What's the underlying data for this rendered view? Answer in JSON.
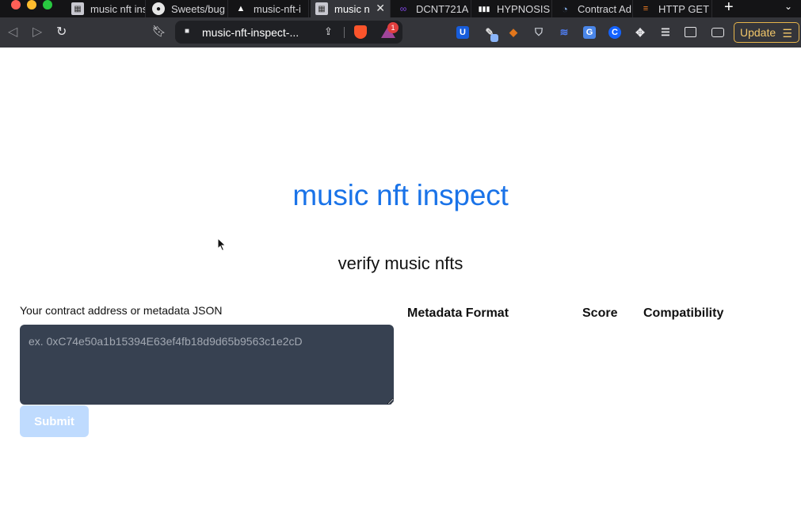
{
  "browser": {
    "tabs": [
      {
        "label": "music nft ins",
        "favicon": "music-nft-favicon-icon",
        "active": false
      },
      {
        "label": "Sweets/bug",
        "favicon": "github-icon",
        "active": false
      },
      {
        "label": "music-nft-i",
        "favicon": "vercel-icon",
        "active": false
      },
      {
        "label": "music n",
        "favicon": "music-nft-favicon-icon",
        "active": true
      },
      {
        "label": "DCNT721A",
        "favicon": "polygon-icon",
        "active": false
      },
      {
        "label": "HYPNOSIS",
        "favicon": "audio-wave-icon",
        "active": false
      },
      {
        "label": "Contract Ad",
        "favicon": "etherscan-icon",
        "active": false
      },
      {
        "label": "HTTP GET r",
        "favicon": "stackoverflow-icon",
        "active": false
      }
    ],
    "url": "music-nft-inspect-...",
    "rewards_badge": "1",
    "update_label": "Update",
    "colors": {
      "tabbar": "#141416",
      "toolbar": "#34353a",
      "accent": "#e7b54b"
    }
  },
  "page": {
    "title": "music nft inspect",
    "subtitle": "verify music nfts",
    "input_label": "Your contract address or metadata JSON",
    "input_placeholder": "ex. 0xC74e50a1b15394E63ef4fb18d9d65b9563c1e2cD",
    "input_value": "",
    "submit_label": "Submit",
    "columns": [
      "Metadata Format",
      "Score",
      "Compatibility"
    ],
    "colors": {
      "title": "#1a73e8",
      "textarea": "#374151",
      "submit_disabled": "#bfdbfe"
    }
  }
}
